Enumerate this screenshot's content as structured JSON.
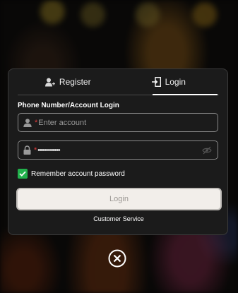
{
  "tabs": {
    "register_label": "Register",
    "login_label": "Login",
    "active": "login"
  },
  "form": {
    "section_title": "Phone Number/Account Login",
    "account": {
      "required_mark": "*",
      "placeholder": "Enter account",
      "value": ""
    },
    "password": {
      "required_mark": "*",
      "masked_value": "•••••••••••"
    },
    "remember": {
      "label": "Remember account password",
      "checked": true
    },
    "login_button_label": "Login",
    "customer_service_label": "Customer Service"
  },
  "icons": {
    "register_tab": "user-plus-icon",
    "login_tab": "login-door-icon",
    "account_field": "user-icon",
    "password_field": "lock-icon",
    "password_toggle": "eye-slash-icon",
    "remember": "checkmark-icon",
    "close": "close-circle-icon"
  },
  "colors": {
    "modal_bg": "#1b1b1b",
    "required": "#e23b3b",
    "checkbox": "#22b14c",
    "login_button_bg": "#f2eeea",
    "login_button_text": "#9c9894"
  }
}
